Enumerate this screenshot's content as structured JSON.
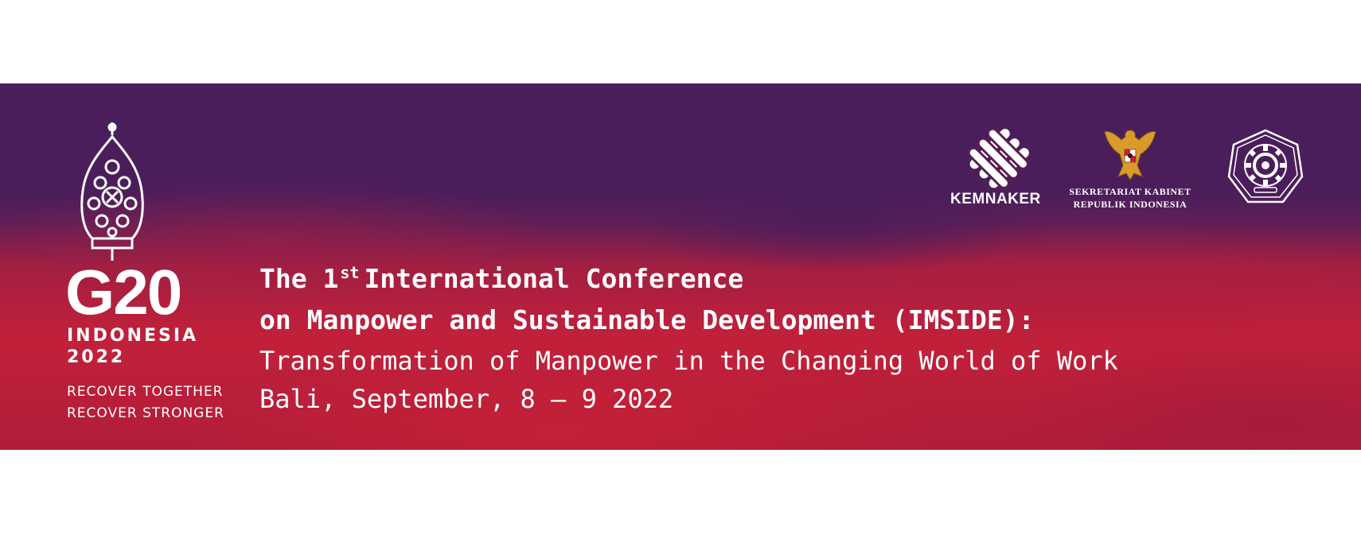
{
  "g20": {
    "mark": "G20",
    "country": "INDONESIA",
    "year": "2022",
    "tagline_1": "RECOVER TOGETHER",
    "tagline_2": "RECOVER STRONGER"
  },
  "title": {
    "line1_pre": "The 1",
    "line1_sup": "st",
    "line1_post": "International Conference",
    "line2": "on Manpower and Sustainable Development (IMSIDE):",
    "line3": "Transformation of Manpower in the Changing World of Work",
    "line4": "Bali, September, 8 – 9 2022"
  },
  "logos": {
    "kemnaker": "KEMNAKER",
    "seskab_1": "SEKRETARIAT KABINET",
    "seskab_2": "REPUBLIK INDONESIA"
  },
  "colors": {
    "purple": "#4a1f5c",
    "red": "#c2203a",
    "text": "#ffffff",
    "gold": "#d99a2b"
  }
}
